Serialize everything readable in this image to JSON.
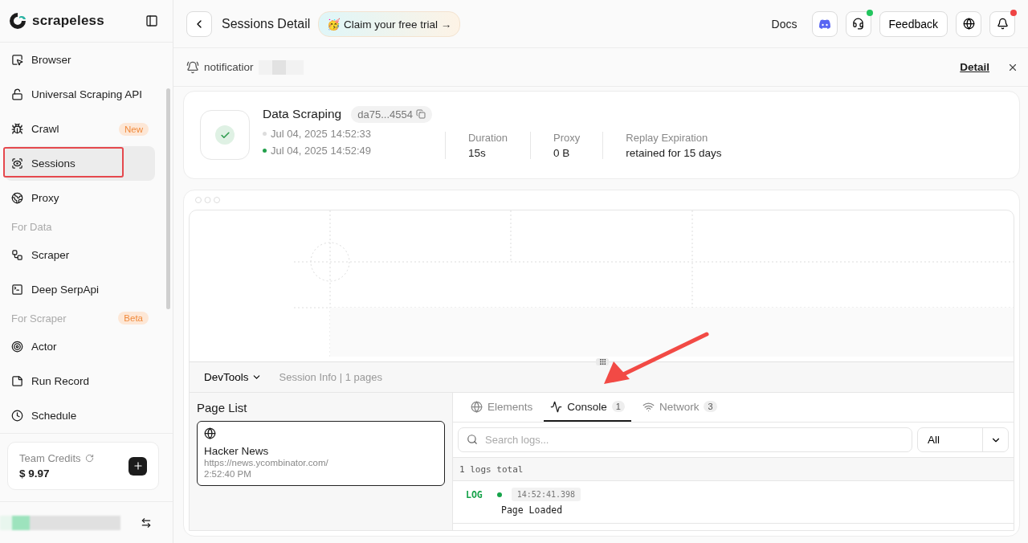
{
  "brand": {
    "name": "scrapeless"
  },
  "sidebar": {
    "items": [
      {
        "kind": "item",
        "label": "Browser",
        "selected": false
      },
      {
        "kind": "item",
        "label": "Universal Scraping API",
        "selected": false
      },
      {
        "kind": "item",
        "label": "Crawl",
        "badge": "New",
        "selected": false
      },
      {
        "kind": "item",
        "label": "Sessions",
        "selected": true
      },
      {
        "kind": "item",
        "label": "Proxy",
        "selected": false
      },
      {
        "kind": "section",
        "label": "For Data"
      },
      {
        "kind": "item",
        "label": "Scraper",
        "selected": false
      },
      {
        "kind": "item",
        "label": "Deep SerpApi",
        "selected": false
      },
      {
        "kind": "section",
        "label": "For Scraper",
        "badge": "Beta"
      },
      {
        "kind": "item",
        "label": "Actor",
        "selected": false
      },
      {
        "kind": "item",
        "label": "Run Record",
        "selected": false
      },
      {
        "kind": "item",
        "label": "Schedule",
        "selected": false
      }
    ],
    "credits": {
      "label": "Team Credits",
      "value": "$ 9.97"
    }
  },
  "header": {
    "title": "Sessions Detail",
    "promo": "🥳 Claim your free trial →",
    "docs": "Docs",
    "feedback": "Feedback"
  },
  "notification": {
    "text": "notificatior",
    "link": "Detail"
  },
  "session": {
    "name": "Data Scraping",
    "id": "da75...4554",
    "start": "Jul 04, 2025 14:52:33",
    "end": "Jul 04, 2025 14:52:49",
    "stats": [
      {
        "label": "Duration",
        "value": "15s"
      },
      {
        "label": "Proxy",
        "value": "0 B"
      },
      {
        "label": "Replay Expiration",
        "value": "retained for 15 days"
      }
    ]
  },
  "devtools": {
    "menu": "DevTools",
    "info": "Session Info | 1 pages",
    "page_list": {
      "title": "Page List",
      "pages": [
        {
          "title": "Hacker News",
          "url": "https://news.ycombinator.com/",
          "time": "2:52:40 PM",
          "selected": true
        }
      ]
    },
    "tabs": [
      {
        "label": "Elements",
        "selected": false
      },
      {
        "label": "Console",
        "count": "1",
        "selected": true
      },
      {
        "label": "Network",
        "count": "3",
        "selected": false
      }
    ],
    "search": {
      "placeholder": "Search logs..."
    },
    "filter": "All",
    "total": "1 logs total",
    "logs": [
      {
        "level": "LOG",
        "time": "14:52:41.398",
        "message": "Page Loaded",
        "color": "#16a34a"
      }
    ]
  }
}
